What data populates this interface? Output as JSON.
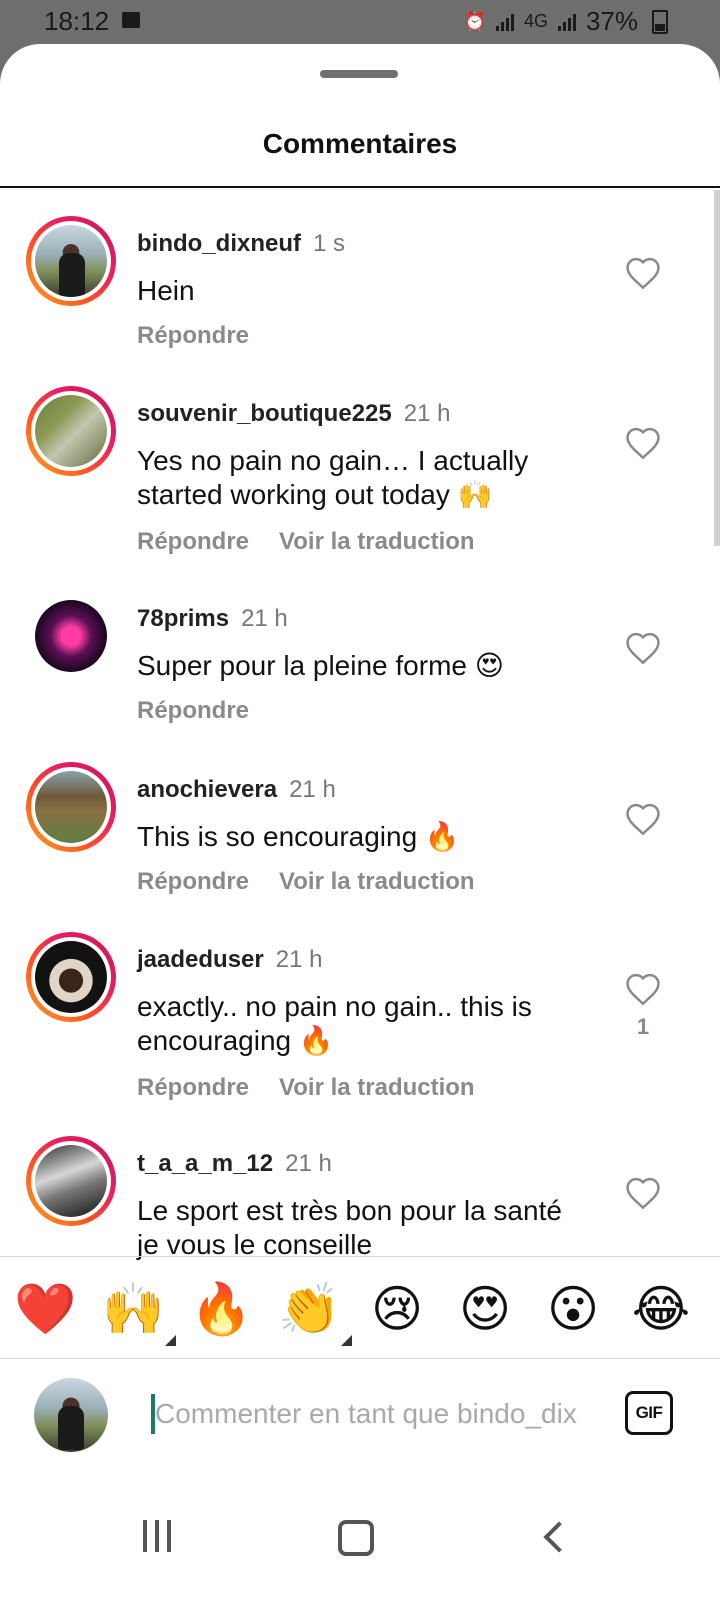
{
  "status_bar": {
    "time": "18:12",
    "network": "4G",
    "battery": "37%"
  },
  "sheet": {
    "title": "Commentaires"
  },
  "comments": [
    {
      "username": "bindo_dixneuf",
      "time": "1 s",
      "text": "Hein",
      "reply": "Répondre",
      "translate": "",
      "likes": ""
    },
    {
      "username": "souvenir_boutique225",
      "time": "21 h",
      "text": "Yes no pain no gain… I actually started working out today 🙌",
      "reply": "Répondre",
      "translate": "Voir la traduction",
      "likes": ""
    },
    {
      "username": "78prims",
      "time": "21 h",
      "text": "Super pour la pleine forme 😍",
      "reply": "Répondre",
      "translate": "",
      "likes": ""
    },
    {
      "username": "anochievera",
      "time": "21 h",
      "text": "This is so encouraging 🔥",
      "reply": "Répondre",
      "translate": "Voir la traduction",
      "likes": ""
    },
    {
      "username": "jaadeduser",
      "time": "21 h",
      "text": "exactly.. no pain no gain.. this is encouraging 🔥",
      "reply": "Répondre",
      "translate": "Voir la traduction",
      "likes": "1"
    },
    {
      "username": "t_a_a_m_12",
      "time": "21 h",
      "text": "Le sport est très bon pour la santé je vous le conseille",
      "reply": "",
      "translate": "",
      "likes": ""
    }
  ],
  "reactions": [
    "❤️",
    "🙌",
    "🔥",
    "👏",
    "😢",
    "😍",
    "😮",
    "😂"
  ],
  "composer": {
    "placeholder": "Commenter en tant que bindo_dix",
    "gif_label": "GIF"
  },
  "colors": {
    "ring_gradient_start": "#f9a825",
    "ring_gradient_end": "#c2185b",
    "caret": "#1d7a72",
    "muted_text": "#8a8a8a"
  }
}
